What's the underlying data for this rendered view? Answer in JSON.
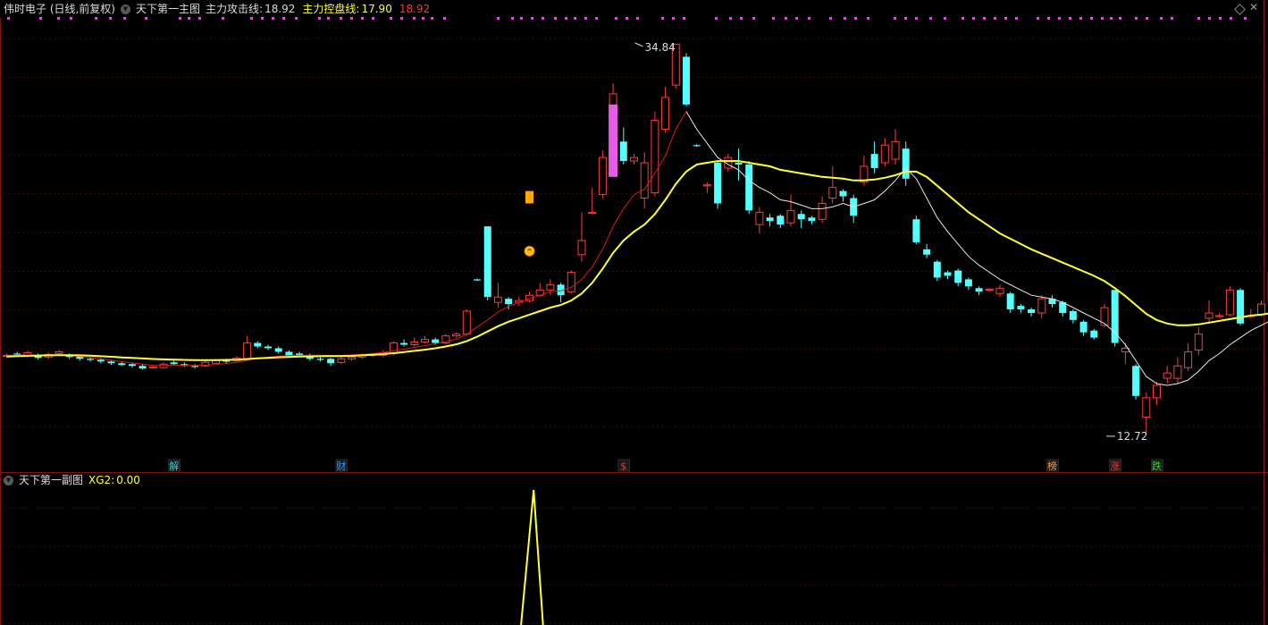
{
  "main_panel": {
    "stock_label": "伟时电子 (日线,前复权)",
    "indicator_name": "天下第一主图",
    "attack_label": "主力攻击线:",
    "attack_value": "18.92",
    "control_label": "主力控盘线:",
    "control_value": "17.90",
    "extra_value": "18.92",
    "high_label": "34.84",
    "low_label": "12.72"
  },
  "sub_panel": {
    "indicator_name": "天下第一副图",
    "xg2_label": "XG2:",
    "xg2_value": "0.00"
  },
  "colors": {
    "up": "#ff3b3b",
    "down": "#54ffff",
    "attack_line": "#e11a1a",
    "white_line": "#e8e8e8",
    "control_line": "#ffff33",
    "grid": "#3a0d0d",
    "magenta": "#ff33ff"
  },
  "chart_data": {
    "type": "candlestick",
    "ylim": [
      11.5,
      36.2
    ],
    "high_marker": 34.84,
    "low_marker": 12.72,
    "candles": [
      [
        17.15,
        17.2,
        17.3,
        17.05
      ],
      [
        17.3,
        17.25,
        17.4,
        17.15
      ],
      [
        17.2,
        17.35,
        17.45,
        17.1
      ],
      [
        17.2,
        17.05,
        17.3,
        16.95
      ],
      [
        17.1,
        17.25,
        17.35,
        17.0
      ],
      [
        17.3,
        17.4,
        17.5,
        17.2
      ],
      [
        17.2,
        17.1,
        17.3,
        17.0
      ],
      [
        17.15,
        17.0,
        17.25,
        16.9
      ],
      [
        17.0,
        16.95,
        17.1,
        16.85
      ],
      [
        16.95,
        16.85,
        17.05,
        16.75
      ],
      [
        16.85,
        16.75,
        16.95,
        16.65
      ],
      [
        16.75,
        16.65,
        16.85,
        16.6
      ],
      [
        16.7,
        16.6,
        16.75,
        16.5
      ],
      [
        16.6,
        16.45,
        16.7,
        16.4
      ],
      [
        16.5,
        16.55,
        16.6,
        16.45
      ],
      [
        16.5,
        16.7,
        16.8,
        16.45
      ],
      [
        16.8,
        16.7,
        16.9,
        16.65
      ],
      [
        16.7,
        16.6,
        16.8,
        16.55
      ],
      [
        16.6,
        16.55,
        16.7,
        16.45
      ],
      [
        16.6,
        16.8,
        16.9,
        16.55
      ],
      [
        16.75,
        16.9,
        17.0,
        16.7
      ],
      [
        16.9,
        16.85,
        17.0,
        16.75
      ],
      [
        16.9,
        17.05,
        17.15,
        16.85
      ],
      [
        17.0,
        17.9,
        18.3,
        16.95
      ],
      [
        17.9,
        17.7,
        18.0,
        17.6
      ],
      [
        17.7,
        17.6,
        17.8,
        17.5
      ],
      [
        17.6,
        17.4,
        17.7,
        17.3
      ],
      [
        17.4,
        17.2,
        17.5,
        17.1
      ],
      [
        17.3,
        17.2,
        17.4,
        17.1
      ],
      [
        17.2,
        17.0,
        17.3,
        16.9
      ],
      [
        17.0,
        16.95,
        17.1,
        16.85
      ],
      [
        17.0,
        16.75,
        17.05,
        16.6
      ],
      [
        16.8,
        17.0,
        17.1,
        16.7
      ],
      [
        17.0,
        17.1,
        17.2,
        16.9
      ],
      [
        17.1,
        17.2,
        17.3,
        17.0
      ],
      [
        17.2,
        17.25,
        17.3,
        17.1
      ],
      [
        17.2,
        17.35,
        17.5,
        17.1
      ],
      [
        17.3,
        17.9,
        18.0,
        17.2
      ],
      [
        17.9,
        17.8,
        18.1,
        17.7
      ],
      [
        17.8,
        17.95,
        18.2,
        17.7
      ],
      [
        17.95,
        18.1,
        18.3,
        17.85
      ],
      [
        18.1,
        17.9,
        18.2,
        17.8
      ],
      [
        17.9,
        18.3,
        18.4,
        17.8
      ],
      [
        18.3,
        18.4,
        18.5,
        18.2
      ],
      [
        18.4,
        19.7,
        19.8,
        18.3
      ],
      [
        21.5,
        21.45,
        21.55,
        21.4
      ],
      [
        24.5,
        20.5,
        24.5,
        20.3
      ],
      [
        20.2,
        20.5,
        21.3,
        19.9
      ],
      [
        20.4,
        20.1,
        20.5,
        19.8
      ],
      [
        20.2,
        20.3,
        20.5,
        20.0
      ],
      [
        20.3,
        20.6,
        20.8,
        20.2
      ],
      [
        20.6,
        20.9,
        21.3,
        20.5
      ],
      [
        20.9,
        21.2,
        21.5,
        20.6
      ],
      [
        21.2,
        20.6,
        21.3,
        20.2
      ],
      [
        20.8,
        21.9,
        22.0,
        20.7
      ],
      [
        22.9,
        23.7,
        25.3,
        22.5
      ],
      [
        25.3,
        25.3,
        26.7,
        25.2
      ],
      [
        26.3,
        28.4,
        28.8,
        26.1
      ],
      [
        29.7,
        32.0,
        32.6,
        29.5
      ],
      [
        29.3,
        28.2,
        30.1,
        28.0
      ],
      [
        28.2,
        28.4,
        28.6,
        28.0
      ],
      [
        26.1,
        28.1,
        28.7,
        25.5
      ],
      [
        26.4,
        30.5,
        31.0,
        26.2
      ],
      [
        30.0,
        31.8,
        32.4,
        29.8
      ],
      [
        32.5,
        34.8,
        34.84,
        32.3
      ],
      [
        34.1,
        31.4,
        34.3,
        31.3
      ],
      [
        29.1,
        29.05,
        29.15,
        29.0
      ],
      [
        26.8,
        26.85,
        27.0,
        26.4
      ],
      [
        28.1,
        25.8,
        28.2,
        25.5
      ],
      [
        27.8,
        28.4,
        28.6,
        27.6
      ],
      [
        28.1,
        28.0,
        28.9,
        27.1
      ],
      [
        28.0,
        25.4,
        28.2,
        25.2
      ],
      [
        24.6,
        25.3,
        25.6,
        24.1
      ],
      [
        25.0,
        24.8,
        25.2,
        24.5
      ],
      [
        25.1,
        24.6,
        25.2,
        24.4
      ],
      [
        24.7,
        25.4,
        26.3,
        24.5
      ],
      [
        25.2,
        24.9,
        25.4,
        24.4
      ],
      [
        25.0,
        24.8,
        25.1,
        24.6
      ],
      [
        24.9,
        25.8,
        26.2,
        24.7
      ],
      [
        26.1,
        26.7,
        27.9,
        25.8
      ],
      [
        26.5,
        26.2,
        26.6,
        25.9
      ],
      [
        26.1,
        25.1,
        26.3,
        24.7
      ],
      [
        27.0,
        27.9,
        28.5,
        26.8
      ],
      [
        28.6,
        27.8,
        29.3,
        27.5
      ],
      [
        28.1,
        29.1,
        29.5,
        27.9
      ],
      [
        28.3,
        29.3,
        30.0,
        28.0
      ],
      [
        28.9,
        27.2,
        29.3,
        26.8
      ],
      [
        24.9,
        23.6,
        25.1,
        23.5
      ],
      [
        23.2,
        22.9,
        23.5,
        22.7
      ],
      [
        22.5,
        21.6,
        22.6,
        21.4
      ],
      [
        21.9,
        21.7,
        22.0,
        21.5
      ],
      [
        22.0,
        21.3,
        22.1,
        21.1
      ],
      [
        21.5,
        21.1,
        21.6,
        20.9
      ],
      [
        21.0,
        20.8,
        21.1,
        20.6
      ],
      [
        20.9,
        20.95,
        21.0,
        20.8
      ],
      [
        20.7,
        21.0,
        21.2,
        20.5
      ],
      [
        20.7,
        19.8,
        20.8,
        19.6
      ],
      [
        20.0,
        19.8,
        20.1,
        19.6
      ],
      [
        19.8,
        19.6,
        19.9,
        19.4
      ],
      [
        19.6,
        20.4,
        20.6,
        19.3
      ],
      [
        20.4,
        20.1,
        20.6,
        19.9
      ],
      [
        20.2,
        19.6,
        20.3,
        19.4
      ],
      [
        19.7,
        19.2,
        19.8,
        19.0
      ],
      [
        19.1,
        18.5,
        19.2,
        18.3
      ],
      [
        18.6,
        18.2,
        18.7,
        18.1
      ],
      [
        18.9,
        19.9,
        20.1,
        18.8
      ],
      [
        20.9,
        17.9,
        20.9,
        17.7
      ],
      [
        17.4,
        17.6,
        17.9,
        16.7
      ],
      [
        16.6,
        14.9,
        16.7,
        14.7
      ],
      [
        13.7,
        14.8,
        15.1,
        12.72
      ],
      [
        14.8,
        15.5,
        15.7,
        14.4
      ],
      [
        15.9,
        16.2,
        16.6,
        15.6
      ],
      [
        15.9,
        16.6,
        17.1,
        15.6
      ],
      [
        16.5,
        17.4,
        17.9,
        16.3
      ],
      [
        17.5,
        18.4,
        18.8,
        17.2
      ],
      [
        19.3,
        19.6,
        20.3,
        19.0
      ],
      [
        19.4,
        19.45,
        19.6,
        19.3
      ],
      [
        19.5,
        20.9,
        21.1,
        19.4
      ],
      [
        20.9,
        19.0,
        21.0,
        18.9
      ],
      [
        19.4,
        19.45,
        19.8,
        19.3
      ],
      [
        19.5,
        20.1,
        20.3,
        19.4
      ],
      [
        20.2,
        21.9,
        22.2,
        19.7
      ]
    ],
    "series": [
      {
        "name": "主力攻击线",
        "values": [
          17.2,
          17.2,
          17.22,
          17.2,
          17.2,
          17.22,
          17.19,
          17.14,
          17.08,
          17.0,
          16.92,
          16.84,
          16.77,
          16.7,
          16.63,
          16.62,
          16.63,
          16.63,
          16.62,
          16.64,
          16.68,
          16.74,
          16.8,
          16.92,
          17.03,
          17.1,
          17.15,
          17.18,
          17.2,
          17.21,
          17.21,
          17.2,
          17.2,
          17.22,
          17.25,
          17.3,
          17.36,
          17.45,
          17.55,
          17.65,
          17.75,
          17.85,
          17.97,
          18.12,
          18.4,
          18.8,
          19.2,
          19.65,
          19.98,
          20.2,
          20.4,
          20.6,
          20.8,
          20.85,
          21.05,
          21.5,
          22.2,
          23.2,
          24.5,
          25.5,
          26.3,
          26.6,
          27.5,
          28.5,
          30.0,
          31.0,
          30.0,
          29.2,
          28.4,
          28.0,
          27.7,
          27.1,
          26.7,
          26.4,
          26.0,
          25.9,
          25.7,
          25.5,
          25.5,
          25.6,
          25.8,
          25.6,
          25.8,
          26.0,
          26.5,
          27.1,
          27.8,
          27.2,
          26.1,
          25.0,
          24.2,
          23.5,
          22.8,
          22.3,
          21.9,
          21.5,
          21.2,
          20.9,
          20.6,
          20.5,
          20.4,
          20.2,
          19.9,
          19.6,
          19.3,
          19.0,
          18.5,
          17.8,
          16.9,
          16.0,
          15.6,
          15.5,
          15.6,
          15.8,
          16.3,
          16.9,
          17.3,
          17.8,
          18.2,
          18.6,
          18.9,
          19.2,
          19.4,
          19.9
        ]
      },
      {
        "name": "主力控盘线",
        "values": [
          17.13,
          17.15,
          17.17,
          17.19,
          17.2,
          17.21,
          17.21,
          17.2,
          17.18,
          17.15,
          17.12,
          17.08,
          17.05,
          17.02,
          16.99,
          16.97,
          16.95,
          16.94,
          16.93,
          16.93,
          16.93,
          16.94,
          16.95,
          16.99,
          17.03,
          17.06,
          17.09,
          17.11,
          17.13,
          17.14,
          17.15,
          17.16,
          17.16,
          17.17,
          17.2,
          17.23,
          17.27,
          17.32,
          17.38,
          17.45,
          17.52,
          17.6,
          17.7,
          17.82,
          18.0,
          18.25,
          18.55,
          18.85,
          19.1,
          19.3,
          19.5,
          19.7,
          19.9,
          20.05,
          20.3,
          20.7,
          21.3,
          22.1,
          23.0,
          23.7,
          24.2,
          24.6,
          25.2,
          26.0,
          26.9,
          27.6,
          28.0,
          28.1,
          28.2,
          28.2,
          28.2,
          28.1,
          28.0,
          27.9,
          27.7,
          27.6,
          27.5,
          27.4,
          27.3,
          27.25,
          27.2,
          27.1,
          27.1,
          27.15,
          27.25,
          27.4,
          27.6,
          27.6,
          27.3,
          26.8,
          26.3,
          25.8,
          25.3,
          24.9,
          24.5,
          24.1,
          23.8,
          23.5,
          23.2,
          22.95,
          22.7,
          22.45,
          22.2,
          21.95,
          21.7,
          21.4,
          21.0,
          20.55,
          20.05,
          19.55,
          19.2,
          19.0,
          18.9,
          18.9,
          18.95,
          19.05,
          19.15,
          19.25,
          19.35,
          19.45,
          19.5,
          19.6,
          19.7,
          19.85
        ]
      }
    ],
    "signal_markers": [
      {
        "label": "解",
        "candle": 16,
        "color": "#33cccc"
      },
      {
        "label": "财",
        "candle": 32,
        "color": "#3399ff"
      },
      {
        "label": "$",
        "candle": 59,
        "color": "#ff3333"
      },
      {
        "label": "榜",
        "candle": 100,
        "color": "#ff9933"
      },
      {
        "label": "涨",
        "candle": 106,
        "color": "#ff3333"
      },
      {
        "label": "跌",
        "candle": 110,
        "color": "#33cc33"
      }
    ],
    "sub_chart": {
      "type": "line",
      "name": "XG2",
      "ylim": [
        0,
        1
      ],
      "points": [
        {
          "candle": 49.2,
          "value": 0
        },
        {
          "candle": 50.4,
          "value": 1
        },
        {
          "candle": 51.3,
          "value": 0
        }
      ]
    }
  }
}
